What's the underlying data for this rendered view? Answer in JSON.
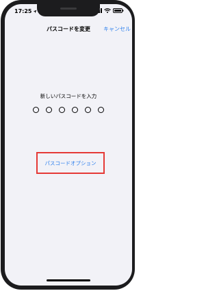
{
  "status_bar": {
    "time": "17:25",
    "location_icon": "location-arrow-icon",
    "signal_icon": "cellular-signal-icon",
    "wifi_icon": "wifi-icon",
    "battery_icon": "battery-icon"
  },
  "nav": {
    "title": "パスコードを変更",
    "cancel_label": "キャンセル"
  },
  "passcode": {
    "prompt": "新しいパスコードを入力",
    "digit_count": 6
  },
  "options": {
    "label": "パスコードオプション"
  },
  "colors": {
    "accent": "#2f80ed",
    "highlight_border": "#e53935",
    "screen_bg": "#f2f2f7",
    "frame": "#1c1c1e"
  }
}
